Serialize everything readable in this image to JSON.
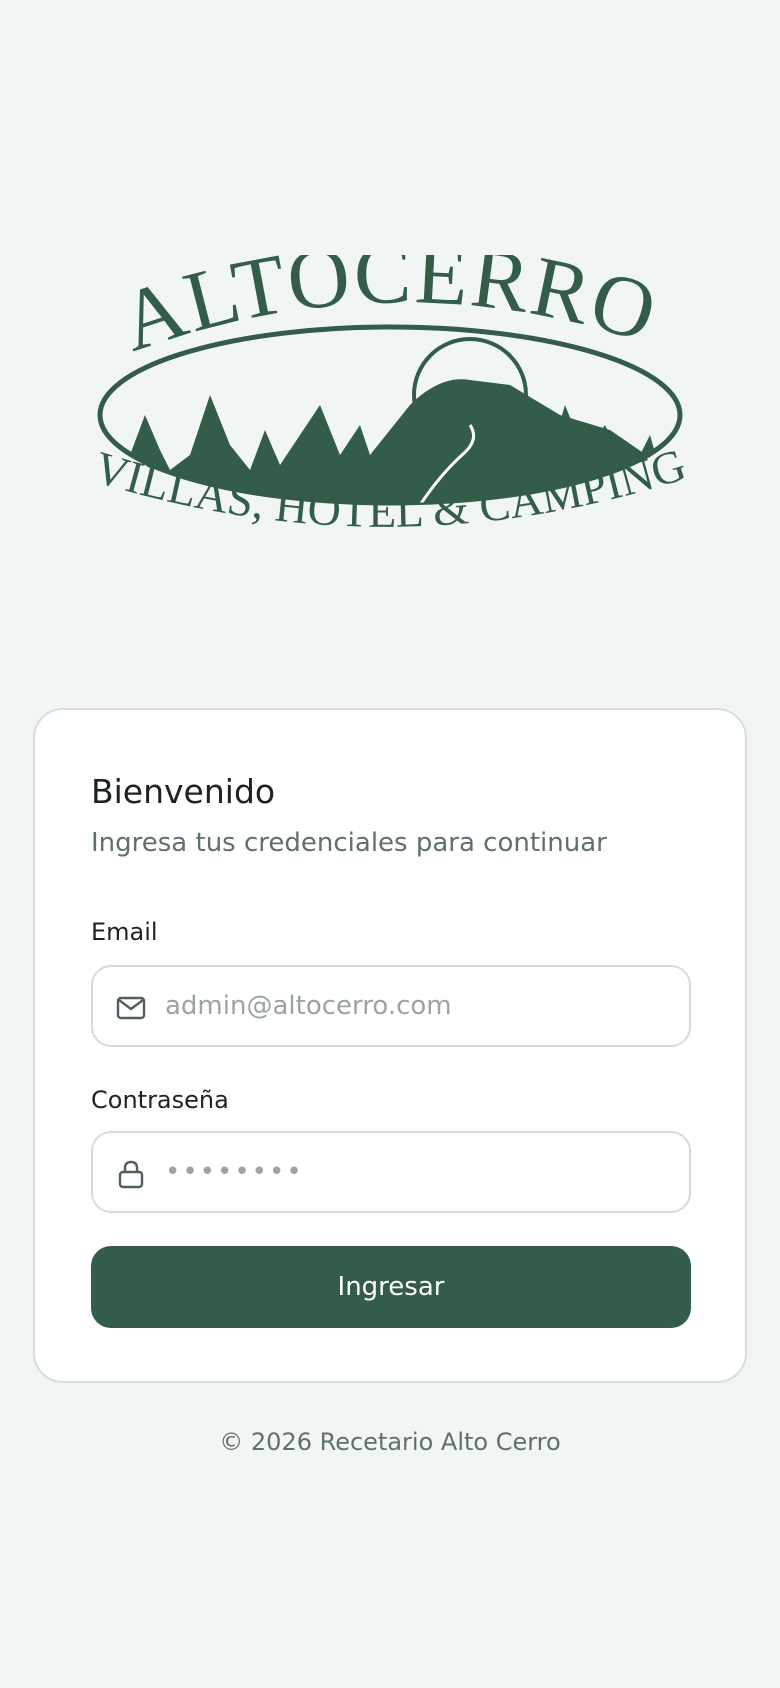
{
  "brand": {
    "logo_top_text": "ALTOCERRO",
    "logo_bottom_text": "VILLAS, HOTEL & CAMPING",
    "color": "#335c49"
  },
  "login": {
    "title": "Bienvenido",
    "subtitle": "Ingresa tus credenciales para continuar",
    "email_label": "Email",
    "email_placeholder": "admin@altocerro.com",
    "email_icon": "mail-icon",
    "password_label": "Contraseña",
    "password_placeholder": "••••••••",
    "password_icon": "lock-icon",
    "submit_label": "Ingresar"
  },
  "footer": {
    "text": "© 2026 Recetario Alto Cerro"
  }
}
